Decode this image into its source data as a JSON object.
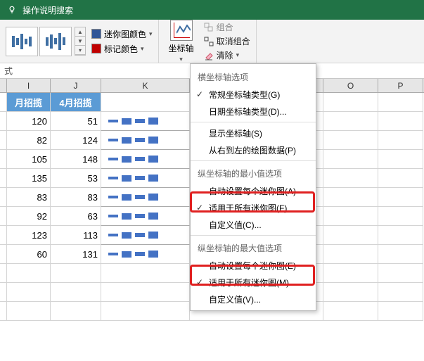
{
  "tellme": {
    "placeholder": "操作说明搜索"
  },
  "ribbon": {
    "spark_color": "迷你图颜色",
    "marker_color": "标记颜色",
    "axis": "坐标轴",
    "group": "组合",
    "ungroup": "取消组合",
    "clear": "清除"
  },
  "formula_gutter": "式",
  "cols": {
    "I": "I",
    "J": "J",
    "K": "K",
    "O": "O",
    "P": "P"
  },
  "headers": {
    "I": "月招揽",
    "J": "4月招揽"
  },
  "rows": [
    {
      "i": 120,
      "j": 51
    },
    {
      "i": 82,
      "j": 124
    },
    {
      "i": 105,
      "j": 148
    },
    {
      "i": 135,
      "j": 53
    },
    {
      "i": 83,
      "j": 83
    },
    {
      "i": 92,
      "j": 63
    },
    {
      "i": 123,
      "j": 113
    },
    {
      "i": 60,
      "j": 131
    }
  ],
  "menu": {
    "h_axis": "横坐标轴选项",
    "general_type": "常规坐标轴类型(G)",
    "date_type": "日期坐标轴类型(D)...",
    "show_axis": "显示坐标轴(S)",
    "rtl": "从右到左的绘图数据(P)",
    "min_hdr": "纵坐标轴的最小值选项",
    "auto_each_a": "自动设置每个迷你图(A)",
    "all_f": "适用于所有迷你图(F)",
    "custom_c": "自定义值(C)...",
    "max_hdr": "纵坐标轴的最大值选项",
    "auto_each_e": "自动设置每个迷你图(E)",
    "all_m": "适用于所有迷你图(M)",
    "custom_v": "自定义值(V)..."
  }
}
